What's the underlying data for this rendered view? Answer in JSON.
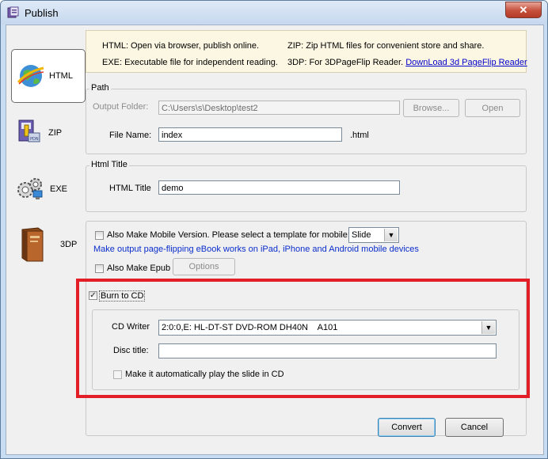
{
  "window": {
    "title": "Publish",
    "close_glyph": "✕"
  },
  "nav": {
    "items": [
      {
        "label": "HTML",
        "icon": "globe-icon",
        "active": true
      },
      {
        "label": "ZIP",
        "icon": "zip-archive-icon",
        "active": false
      },
      {
        "label": "EXE",
        "icon": "gears-icon",
        "active": false
      },
      {
        "label": "3DP",
        "icon": "book-icon",
        "active": false
      }
    ]
  },
  "info": {
    "html": "HTML: Open via browser, publish online.",
    "zip": "ZIP: Zip HTML files for convenient store and share.",
    "exe": "EXE: Executable file for independent reading.",
    "tdp_prefix": "3DP: For 3DPageFlip Reader.",
    "tdp_link": "DownLoad 3d PageFlip Reader"
  },
  "path": {
    "group_title": "Path",
    "output_folder_label": "Output Folder:",
    "output_folder_value": "C:\\Users\\s\\Desktop\\test2",
    "browse_label": "Browse...",
    "open_label": "Open",
    "file_name_label": "File Name:",
    "file_name_value": "index",
    "extension": ".html"
  },
  "html_title": {
    "group_title": "Html Title",
    "label": "HTML Title",
    "value": "demo"
  },
  "options": {
    "mobile_label": "Also Make Mobile Version. Please select a template for mobile:",
    "mobile_checked": false,
    "template_value": "Slide",
    "mobile_note": "Make output page-flipping eBook works on iPad, iPhone and Android mobile devices",
    "epub_label": "Also Make Epub",
    "epub_checked": false,
    "options_button": "Options"
  },
  "cd": {
    "burn_label": "Burn to CD",
    "burn_checked": true,
    "writer_label": "CD Writer",
    "writer_value": "2:0:0,E: HL-DT-ST DVD-ROM DH40N    A101",
    "disc_title_label": "Disc title:",
    "disc_title_value": "",
    "autoplay_label": "Make it automatically play the  slide in CD",
    "autoplay_checked": false
  },
  "footer": {
    "convert_label": "Convert",
    "cancel_label": "Cancel"
  },
  "colors": {
    "highlight": "#e41e26",
    "link": "#0000cc",
    "info_bg": "#fcf7e2"
  }
}
